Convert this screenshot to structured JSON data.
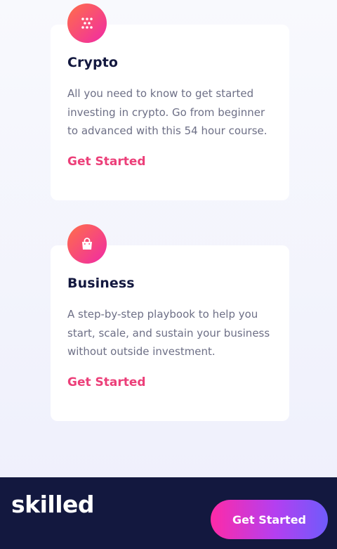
{
  "cards": [
    {
      "title": "Crypto",
      "description": "All you need to know to get started investing in crypto. Go from beginner to advanced with this 54 hour course.",
      "link": "Get Started",
      "icon": "crypto-icon"
    },
    {
      "title": "Business",
      "description": "A step-by-step playbook to help you start, scale, and sustain your business without outside investment.",
      "link": "Get Started",
      "icon": "shopping-bag-icon"
    }
  ],
  "footer": {
    "logo": "skilled",
    "cta_label": "Get Started"
  },
  "colors": {
    "accent": "#ec3f79",
    "dark": "#13183f",
    "text_muted": "#6d6f86",
    "icon_gradient_start": "#ff6f48",
    "icon_gradient_end": "#f02aa6",
    "button_gradient_start": "#fe2aa7",
    "button_gradient_end": "#6f5bfb"
  }
}
